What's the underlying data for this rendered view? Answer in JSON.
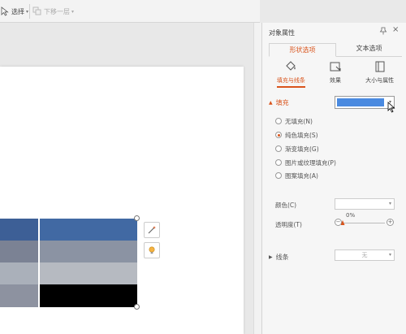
{
  "toolbar": {
    "select_label": "选择",
    "next_label": "下移一层"
  },
  "table": {
    "rows": [
      {
        "colors": [
          "#3d5f96",
          "#3d5f96",
          "#4169a3"
        ]
      },
      {
        "colors": [
          "#7b8294",
          "#7b8294",
          "#8b93a3"
        ]
      },
      {
        "colors": [
          "#aab0ba",
          "#aab0ba",
          "#b6bac1"
        ]
      },
      {
        "colors": [
          "#8d92a0",
          "#8d92a0",
          "#000000"
        ]
      }
    ]
  },
  "float_buttons": [
    {
      "icon": "magic-wand-icon"
    },
    {
      "icon": "lightbulb-icon"
    }
  ],
  "panel": {
    "title": "对象属性",
    "close_symbol": "×",
    "tabs": [
      {
        "label": "形状选项",
        "active": true
      },
      {
        "label": "文本选项",
        "active": false
      }
    ],
    "subtabs": [
      {
        "label": "填充与线条",
        "icon": "paint-bucket-icon",
        "active": true
      },
      {
        "label": "效果",
        "icon": "effects-icon",
        "active": false
      },
      {
        "label": "大小与属性",
        "icon": "size-icon",
        "active": false
      }
    ],
    "fill": {
      "section_label": "填充",
      "current_color": "#4a8ae0",
      "options": [
        {
          "label": "无填充(N)",
          "checked": false
        },
        {
          "label": "纯色填充(S)",
          "checked": true
        },
        {
          "label": "渐变填充(G)",
          "checked": false
        },
        {
          "label": "图片或纹理填充(P)",
          "checked": false
        },
        {
          "label": "图案填充(A)",
          "checked": false
        }
      ],
      "color_label": "颜色(C)",
      "transparency_label": "透明度(T)",
      "transparency_value": "0%",
      "transparency_fraction": 0
    },
    "line": {
      "section_label": "线条",
      "value": "无"
    }
  },
  "accent": "#d9541c"
}
